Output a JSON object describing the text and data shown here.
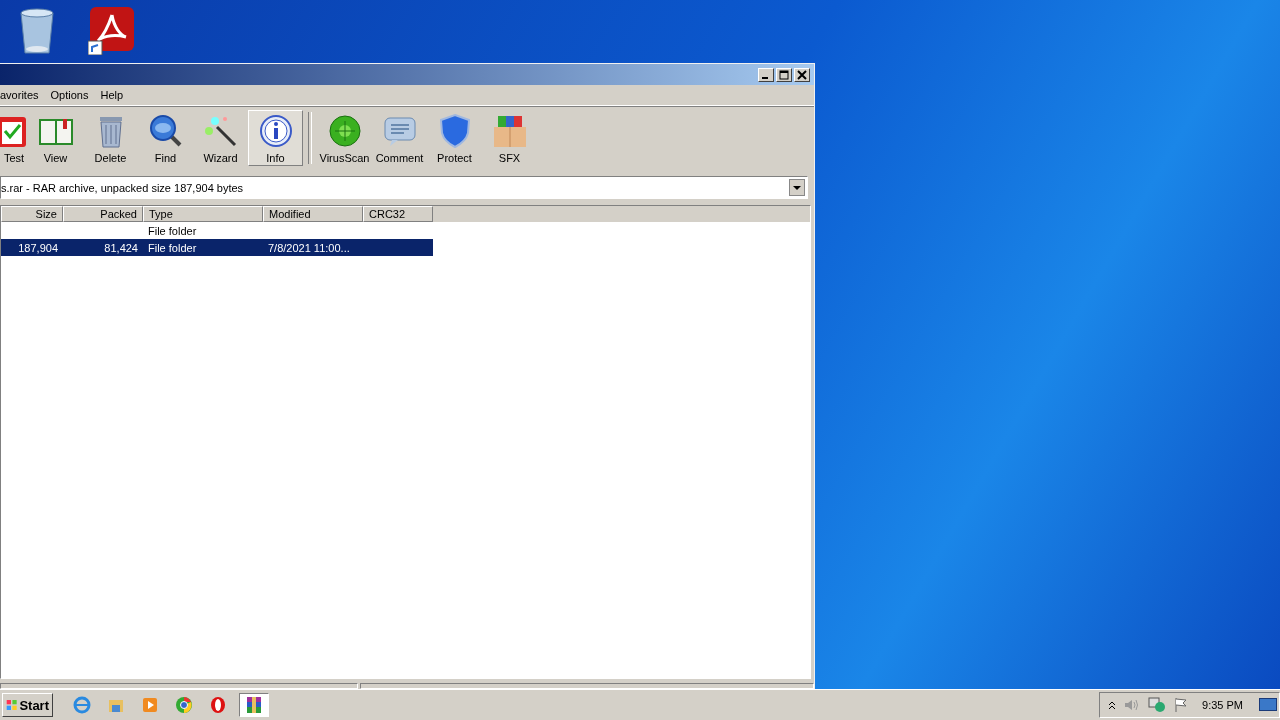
{
  "menu": [
    "avorites",
    "Options",
    "Help"
  ],
  "toolbar": [
    {
      "label": "Test",
      "kind": "test",
      "selected": false
    },
    {
      "label": "View",
      "kind": "view",
      "selected": false
    },
    {
      "label": "Delete",
      "kind": "delete",
      "selected": false
    },
    {
      "label": "Find",
      "kind": "find",
      "selected": false
    },
    {
      "label": "Wizard",
      "kind": "wizard",
      "selected": false
    },
    {
      "label": "Info",
      "kind": "info",
      "selected": true
    },
    {
      "label": "VirusScan",
      "kind": "virus",
      "selected": false
    },
    {
      "label": "Comment",
      "kind": "comment",
      "selected": false
    },
    {
      "label": "Protect",
      "kind": "protect",
      "selected": false
    },
    {
      "label": "SFX",
      "kind": "sfx",
      "selected": false
    }
  ],
  "address": "s.rar - RAR archive, unpacked size 187,904 bytes",
  "table": {
    "columns": [
      "Size",
      "Packed",
      "Type",
      "Modified",
      "CRC32"
    ],
    "rows": [
      {
        "cells": [
          "",
          "",
          "File folder",
          "",
          ""
        ],
        "selected": false
      },
      {
        "cells": [
          "187,904",
          "81,424",
          "File folder",
          "7/8/2021 11:00...",
          ""
        ],
        "selected": true
      }
    ]
  },
  "taskbar": {
    "start": "Start",
    "apps": [
      {
        "kind": "ie",
        "selected": false
      },
      {
        "kind": "folder",
        "selected": false
      },
      {
        "kind": "media",
        "selected": false
      },
      {
        "kind": "chrome",
        "selected": false
      },
      {
        "kind": "opera",
        "selected": false
      },
      {
        "kind": "winrar",
        "selected": true
      }
    ],
    "time": "9:35 PM"
  }
}
